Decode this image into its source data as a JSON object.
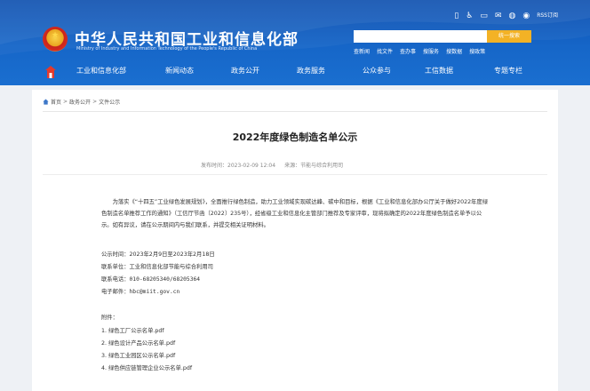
{
  "header": {
    "site_title": "中华人民共和国工业和信息化部",
    "site_subtitle": "Ministry of Industry and Information Technology of the People's Republic of China",
    "rss_label": "RSS订阅",
    "search_placeholder": "",
    "search_button": "统一搜索",
    "hot_links": [
      "查新闻",
      "找文件",
      "查办事",
      "搜服务",
      "搜数据",
      "搜政策"
    ],
    "icons": [
      "mobile-icon",
      "accessibility-icon",
      "phone-icon",
      "mail-icon",
      "weixin-icon",
      "weibo-icon"
    ]
  },
  "nav": {
    "items": [
      "工业和信息化部",
      "新闻动态",
      "政务公开",
      "政务服务",
      "公众参与",
      "工信数据",
      "专题专栏"
    ]
  },
  "breadcrumb": {
    "items": [
      "首页",
      "政务公开",
      "文件公示"
    ]
  },
  "article": {
    "title": "2022年度绿色制造名单公示",
    "meta_date_label": "发布时间：2023-02-09 12:04",
    "meta_source_label": "来源：节能与综合利用司",
    "paragraph1": "为落实《“十四五”工业绿色发展规划》，全面推行绿色制造，助力工业领域实现碳达峰、碳中和目标，根据《工业和信息化部办公厅关于做好2022年度绿色制造名单推荐工作的通知》（工信厅节函〔2022〕235号），经省级工业和信息化主管部门推荐及专家评审，现将拟确定的2022年度绿色制造名单予以公示。如有异议，请在公示期间内与我们联系，并提交相关证明材料。",
    "period": "公示时间：2023年2月9日至2023年2月18日",
    "contact_unit": "联系单位：工业和信息化部节能与综合利用司",
    "phone": "联系电话：010-68205340/68205364",
    "email": "电子邮件：hbc@miit.gov.cn",
    "attachments_label": "附件：",
    "attachments": [
      "1. 绿色工厂公示名单.pdf",
      "2. 绿色设计产品公示名单.pdf",
      "3. 绿色工业园区公示名单.pdf",
      "4. 绿色供应链管理企业公示名单.pdf"
    ]
  },
  "colors": {
    "header_blue": "#1666c8",
    "search_button": "#f3b225"
  }
}
